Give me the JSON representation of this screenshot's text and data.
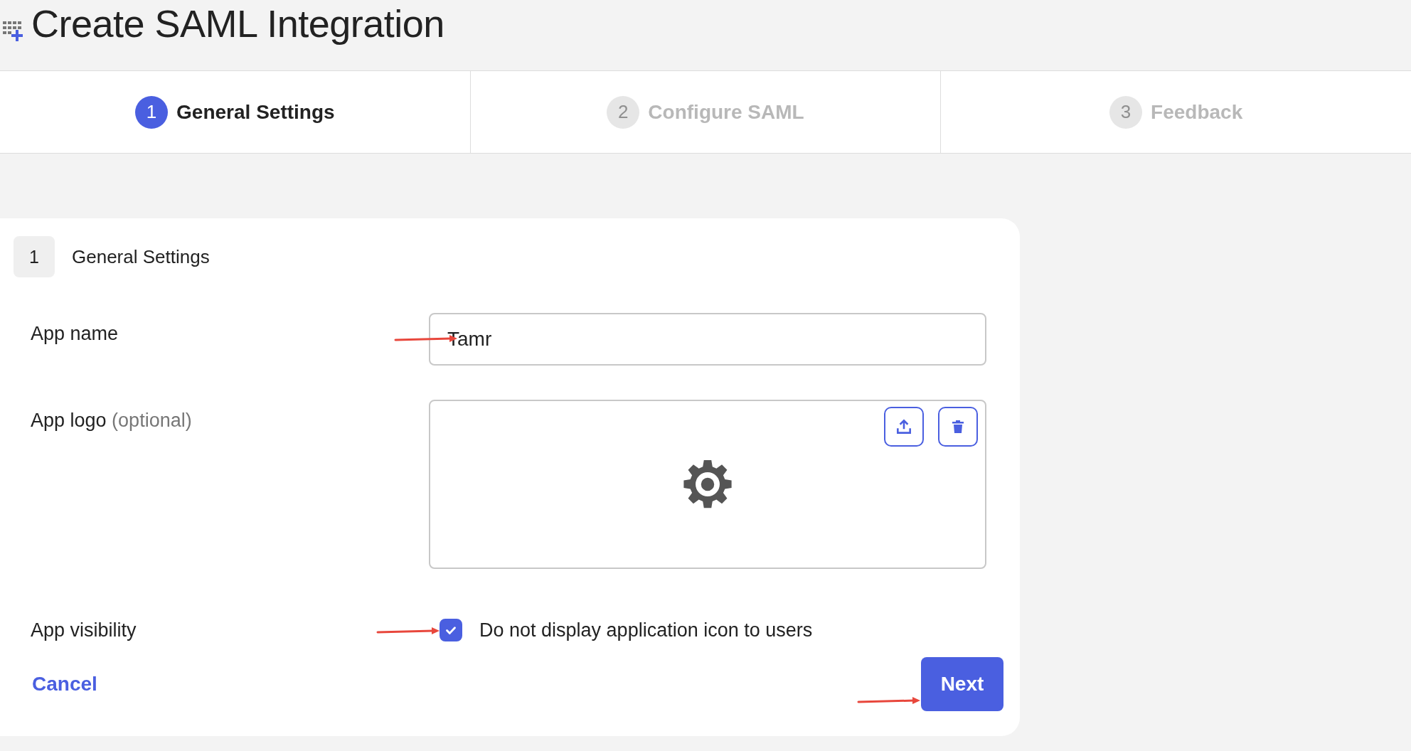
{
  "page": {
    "title": "Create SAML Integration"
  },
  "steps": [
    {
      "number": "1",
      "label": "General Settings",
      "selected": true
    },
    {
      "number": "2",
      "label": "Configure SAML",
      "selected": false
    },
    {
      "number": "3",
      "label": "Feedback",
      "selected": false
    }
  ],
  "section": {
    "number": "1",
    "title": "General Settings"
  },
  "fields": [
    {
      "kind": "text",
      "label": "App name",
      "value": "Tamr",
      "annotated": true
    },
    {
      "kind": "logo",
      "label": "App logo",
      "hint": "(optional)",
      "annotated": false
    },
    {
      "kind": "checkbox",
      "label": "App visibility",
      "option": "Do not display application icon to users",
      "checked": true,
      "annotated": true
    }
  ],
  "actions": {
    "cancel": "Cancel",
    "next": "Next",
    "next_annotated": true
  }
}
